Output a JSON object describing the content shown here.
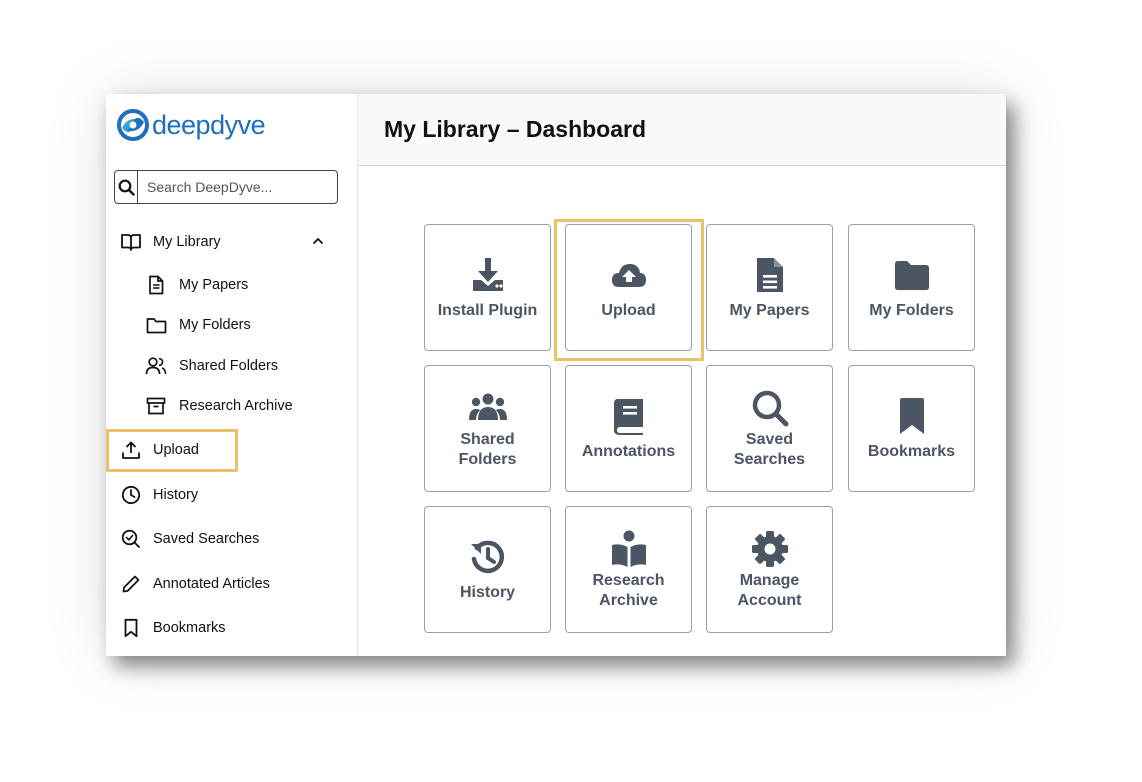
{
  "brand": {
    "name": "deepdyve",
    "color": "#1e6fc0"
  },
  "search": {
    "placeholder": "Search DeepDyve..."
  },
  "sidebar": {
    "items": [
      {
        "label": "My Library",
        "icon": "book-open-icon"
      },
      {
        "label": "My Papers",
        "icon": "document-icon"
      },
      {
        "label": "My Folders",
        "icon": "folder-icon"
      },
      {
        "label": "Shared Folders",
        "icon": "users-icon"
      },
      {
        "label": "Research Archive",
        "icon": "archive-icon"
      },
      {
        "label": "Upload",
        "icon": "upload-icon"
      },
      {
        "label": "History",
        "icon": "clock-icon"
      },
      {
        "label": "Saved Searches",
        "icon": "search-check-icon"
      },
      {
        "label": "Annotated Articles",
        "icon": "pencil-icon"
      },
      {
        "label": "Bookmarks",
        "icon": "bookmark-icon"
      }
    ]
  },
  "main": {
    "title": "My Library – Dashboard",
    "tiles": [
      {
        "label": "Install Plugin",
        "icon": "download-icon"
      },
      {
        "label": "Upload",
        "icon": "cloud-upload-icon"
      },
      {
        "label": "My Papers",
        "icon": "file-text-icon"
      },
      {
        "label": "My Folders",
        "icon": "folder-solid-icon"
      },
      {
        "label": "Shared Folders",
        "icon": "users-solid-icon"
      },
      {
        "label": "Annotations",
        "icon": "book-solid-icon"
      },
      {
        "label": "Saved Searches",
        "icon": "magnifier-icon"
      },
      {
        "label": "Bookmarks",
        "icon": "bookmark-solid-icon"
      },
      {
        "label": "History",
        "icon": "history-icon"
      },
      {
        "label": "Research Archive",
        "icon": "book-reader-icon"
      },
      {
        "label": "Manage Account",
        "icon": "gear-icon"
      }
    ]
  },
  "colors": {
    "highlight": "#e8c36a",
    "tile_icon": "#4b5563"
  }
}
